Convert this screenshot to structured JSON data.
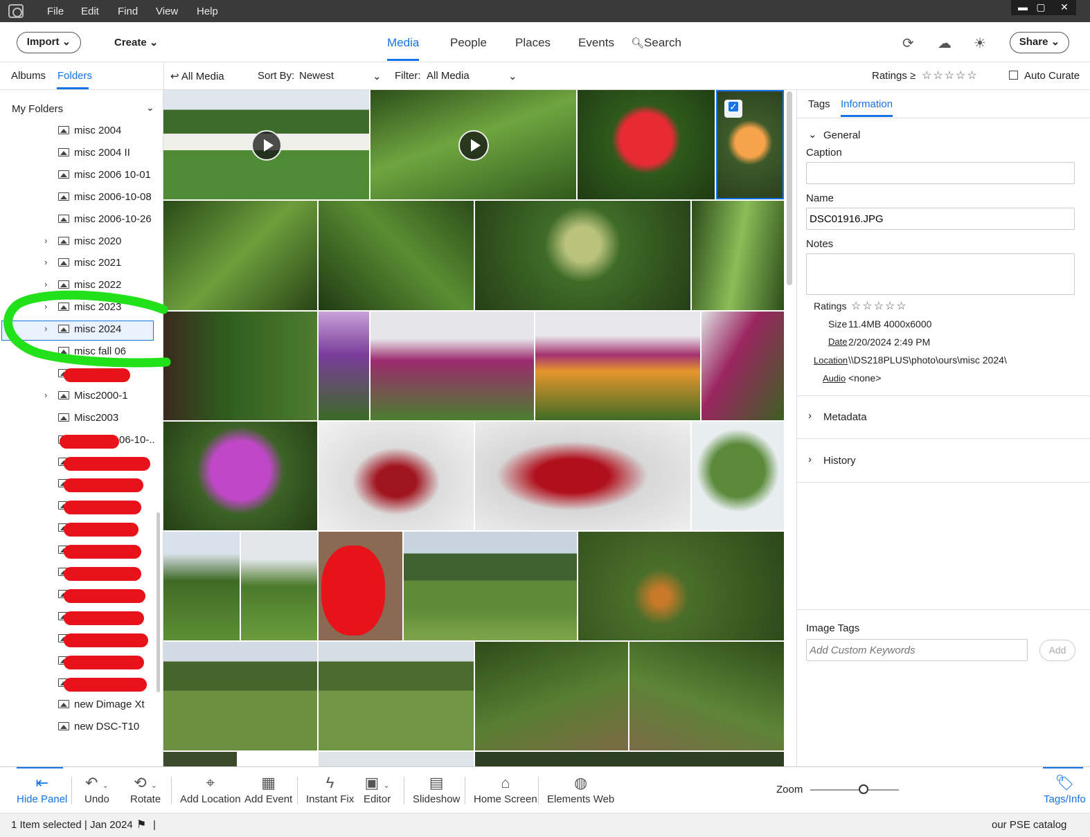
{
  "menu": [
    "File",
    "Edit",
    "Find",
    "View",
    "Help"
  ],
  "window_controls": {
    "minimize": "▬",
    "maximize": "▢",
    "close": "✕"
  },
  "topnav": {
    "import_label": "Import",
    "create_label": "Create",
    "tabs": [
      "Media",
      "People",
      "Places",
      "Events"
    ],
    "search_label": "Search",
    "share_label": "Share"
  },
  "left_tabs": {
    "albums": "Albums",
    "folders": "Folders"
  },
  "filterbar": {
    "back_label": "All Media",
    "sort_by_label": "Sort By:",
    "sort_value": "Newest",
    "filter_label": "Filter:",
    "filter_value": "All Media",
    "ratings_label": "Ratings",
    "ratings_op": "≥",
    "ratings_stars": "☆☆☆☆☆",
    "auto_curate_label": "Auto Curate"
  },
  "folders": {
    "header": "My Folders",
    "items": [
      {
        "label": "misc 2004",
        "expand": false
      },
      {
        "label": "misc 2004 II",
        "expand": false
      },
      {
        "label": "misc 2006 10-01",
        "expand": false
      },
      {
        "label": "misc 2006-10-08",
        "expand": false
      },
      {
        "label": "misc 2006-10-26",
        "expand": false
      },
      {
        "label": "misc 2020",
        "expand": true
      },
      {
        "label": "misc 2021",
        "expand": true
      },
      {
        "label": "misc 2022",
        "expand": true
      },
      {
        "label": "misc 2023",
        "expand": true
      },
      {
        "label": "misc 2024",
        "expand": true,
        "selected": true
      },
      {
        "label": "misc fall 06",
        "expand": false
      },
      {
        "label": "",
        "expand": false
      },
      {
        "label": "Misc2000-1",
        "expand": true
      },
      {
        "label": "Misc2003",
        "expand": false
      },
      {
        "label": "06-10-..",
        "expand": false
      },
      {
        "label": "",
        "expand": false
      },
      {
        "label": "",
        "expand": false
      },
      {
        "label": "",
        "expand": false
      },
      {
        "label": "",
        "expand": false
      },
      {
        "label": "",
        "expand": false
      },
      {
        "label": "",
        "expand": false
      },
      {
        "label": "",
        "expand": false
      },
      {
        "label": "",
        "expand": false
      },
      {
        "label": "",
        "expand": false
      },
      {
        "label": "",
        "expand": false
      },
      {
        "label": "",
        "expand": false
      },
      {
        "label": "new Dimage Xt",
        "expand": false
      },
      {
        "label": "new DSC-T10",
        "expand": false
      }
    ]
  },
  "info_panel": {
    "tabs": {
      "tags": "Tags",
      "information": "Information"
    },
    "general_label": "General",
    "caption_label": "Caption",
    "caption_value": "",
    "name_label": "Name",
    "name_value": "DSC01916.JPG",
    "notes_label": "Notes",
    "notes_value": "",
    "ratings_label": "Ratings",
    "ratings_stars": "☆☆☆☆☆",
    "size_label": "Size",
    "size_value": "11.4MB  4000x6000",
    "date_label": "Date",
    "date_value": "2/20/2024 2:49 PM",
    "location_label": "Location",
    "location_value": "\\\\DS218PLUS\\photo\\ours\\misc 2024\\",
    "audio_label": "Audio",
    "audio_value": "<none>",
    "metadata_label": "Metadata",
    "history_label": "History",
    "image_tags_label": "Image Tags",
    "keywords_placeholder": "Add Custom Keywords",
    "add_label": "Add"
  },
  "toolbar": {
    "hide_panel": "Hide Panel",
    "undo": "Undo",
    "rotate": "Rotate",
    "add_location": "Add Location",
    "add_event": "Add Event",
    "instant_fix": "Instant Fix",
    "editor": "Editor",
    "slideshow": "Slideshow",
    "home_screen": "Home Screen",
    "elements_web": "Elements Web",
    "zoom": "Zoom",
    "tags_info": "Tags/Info"
  },
  "status": {
    "selection": "1 Item selected | Jan 2024",
    "separator": "|",
    "catalog": "our PSE catalog"
  },
  "colors": {
    "accent": "#1473e6",
    "annotation_green": "#22e01a",
    "redaction_red": "#e8121a"
  }
}
